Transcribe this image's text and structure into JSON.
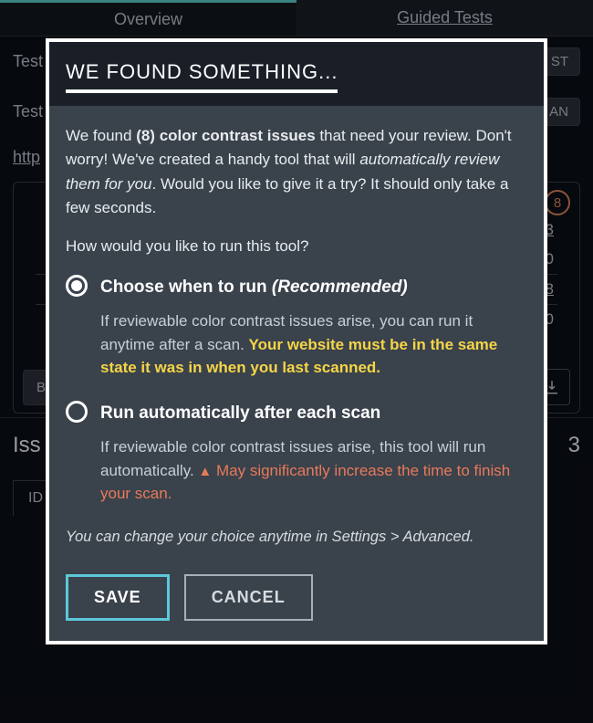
{
  "bg": {
    "tabs": {
      "overview": "Overview",
      "guided": "Guided Tests"
    },
    "row1_label": "Test",
    "row1_btn": "ST",
    "row2_label": "Test",
    "row2_btn": "AN",
    "url": "http",
    "badge": "8",
    "stat1": "3",
    "stat2": "0",
    "stat3": "8",
    "stat4": "0",
    "b_btn": "B",
    "issues_label": "Iss",
    "issues_count": "3",
    "id_tab": "ID"
  },
  "modal": {
    "title": "WE FOUND SOMETHING...",
    "intro": {
      "prefix": "We found ",
      "bold": "(8) color contrast issues",
      "mid1": " that need your review. Don't worry! We've created a handy tool that will ",
      "italic": "automatically review them for you",
      "mid2": ". Would you like to give it a try? It should only take a few seconds."
    },
    "question": "How would you like to run this tool?",
    "option1": {
      "label": "Choose when to run",
      "rec": "(Recommended)",
      "desc_plain": "If reviewable color contrast issues arise, you can run it anytime after a scan. ",
      "desc_highlight": "Your website must be in the same state it was in when you last scanned."
    },
    "option2": {
      "label": "Run automatically after each scan",
      "desc_plain": "If reviewable color contrast issues arise, this tool will run automatically. ",
      "warn_icon": "▲",
      "desc_warn": " May significantly increase the time to finish your scan."
    },
    "settings_note": "You can change your choice anytime in Settings > Advanced.",
    "save": "SAVE",
    "cancel": "CANCEL"
  }
}
